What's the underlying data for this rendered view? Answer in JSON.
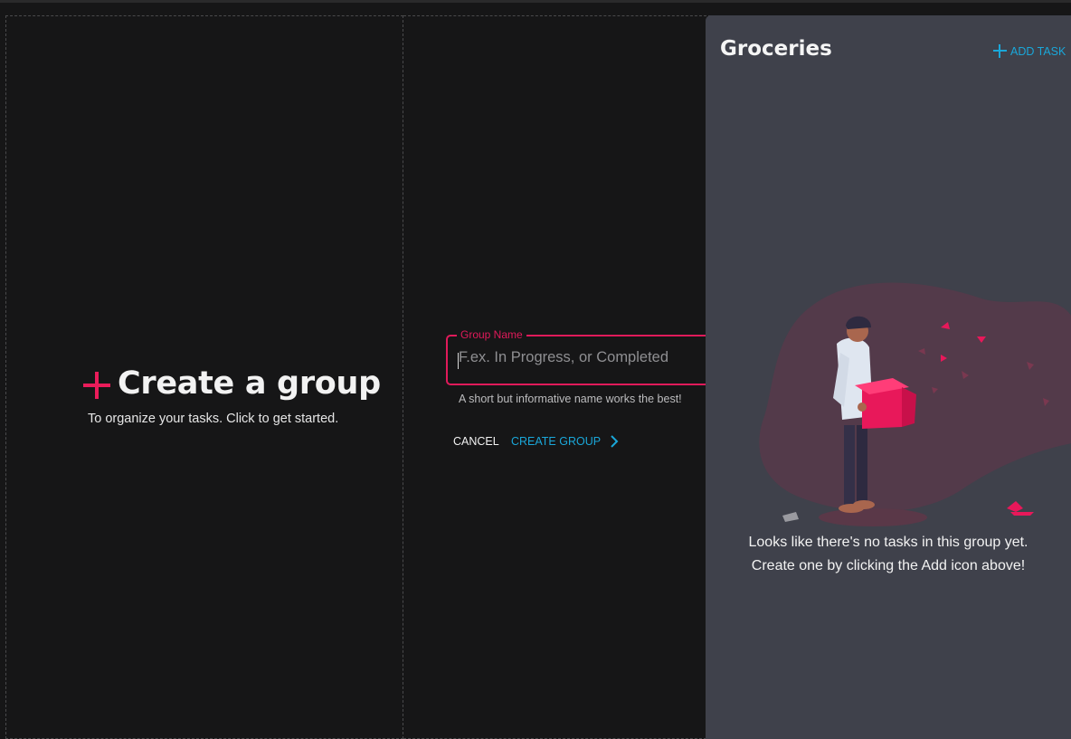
{
  "create_group": {
    "title": "Create a group",
    "subtitle": "To organize your tasks. Click to get started."
  },
  "group_form": {
    "field_label": "Group Name",
    "placeholder": "F.ex. In Progress, or Completed",
    "value": "",
    "helper_text": "A short but informative name works the best!",
    "cancel_label": "CANCEL",
    "create_label": "CREATE GROUP"
  },
  "groceries": {
    "title": "Groceries",
    "add_task_label": "ADD TASK",
    "empty_line1": "Looks like there's no tasks in this group yet.",
    "empty_line2": "Create one by clicking the Add icon above!"
  },
  "colors": {
    "accent_pink": "#e01a5a",
    "accent_blue": "#1aa7d9",
    "background": "#161617",
    "panel": "#3f414b"
  },
  "icons": [
    "plus-icon",
    "chevron-right-icon",
    "add-icon"
  ]
}
